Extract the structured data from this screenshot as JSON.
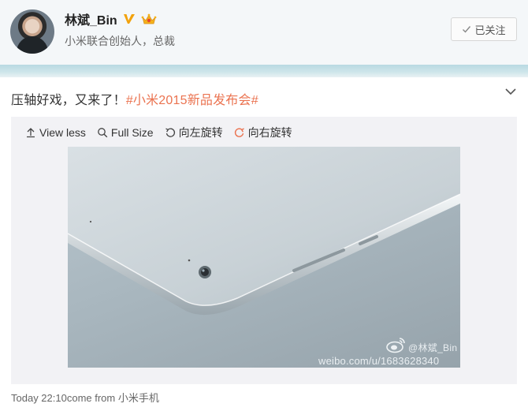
{
  "profile": {
    "name": "林斌_Bin",
    "bio": "小米联合创始人，总裁",
    "follow_label": "已关注"
  },
  "post": {
    "text_plain": "压轴好戏，又来了！",
    "hashtag": "#小米2015新品发布会#"
  },
  "media_toolbar": {
    "view_less": "View less",
    "full_size": "Full Size",
    "rotate_left": "向左旋转",
    "rotate_right": "向右旋转"
  },
  "watermark": {
    "handle": "@林斌_Bin",
    "url": "weibo.com/u/1683628340"
  },
  "footer": {
    "time": "Today 22:10",
    "come_from_label": "come from",
    "source": "小米手机"
  },
  "colors": {
    "hashtag": "#eb7350",
    "verified_badge": "#f2a20c",
    "rotate_right_icon": "#eb7350",
    "stripe": "#b8d9e2"
  },
  "icons": {
    "verified": "v-badge-icon",
    "member": "crown-icon",
    "follow": "checkmark-icon",
    "collapse": "chevron-down-icon",
    "view_less": "arrow-up-icon",
    "full_size": "magnifier-icon",
    "rotate_left": "rotate-left-icon",
    "rotate_right": "rotate-right-icon"
  }
}
